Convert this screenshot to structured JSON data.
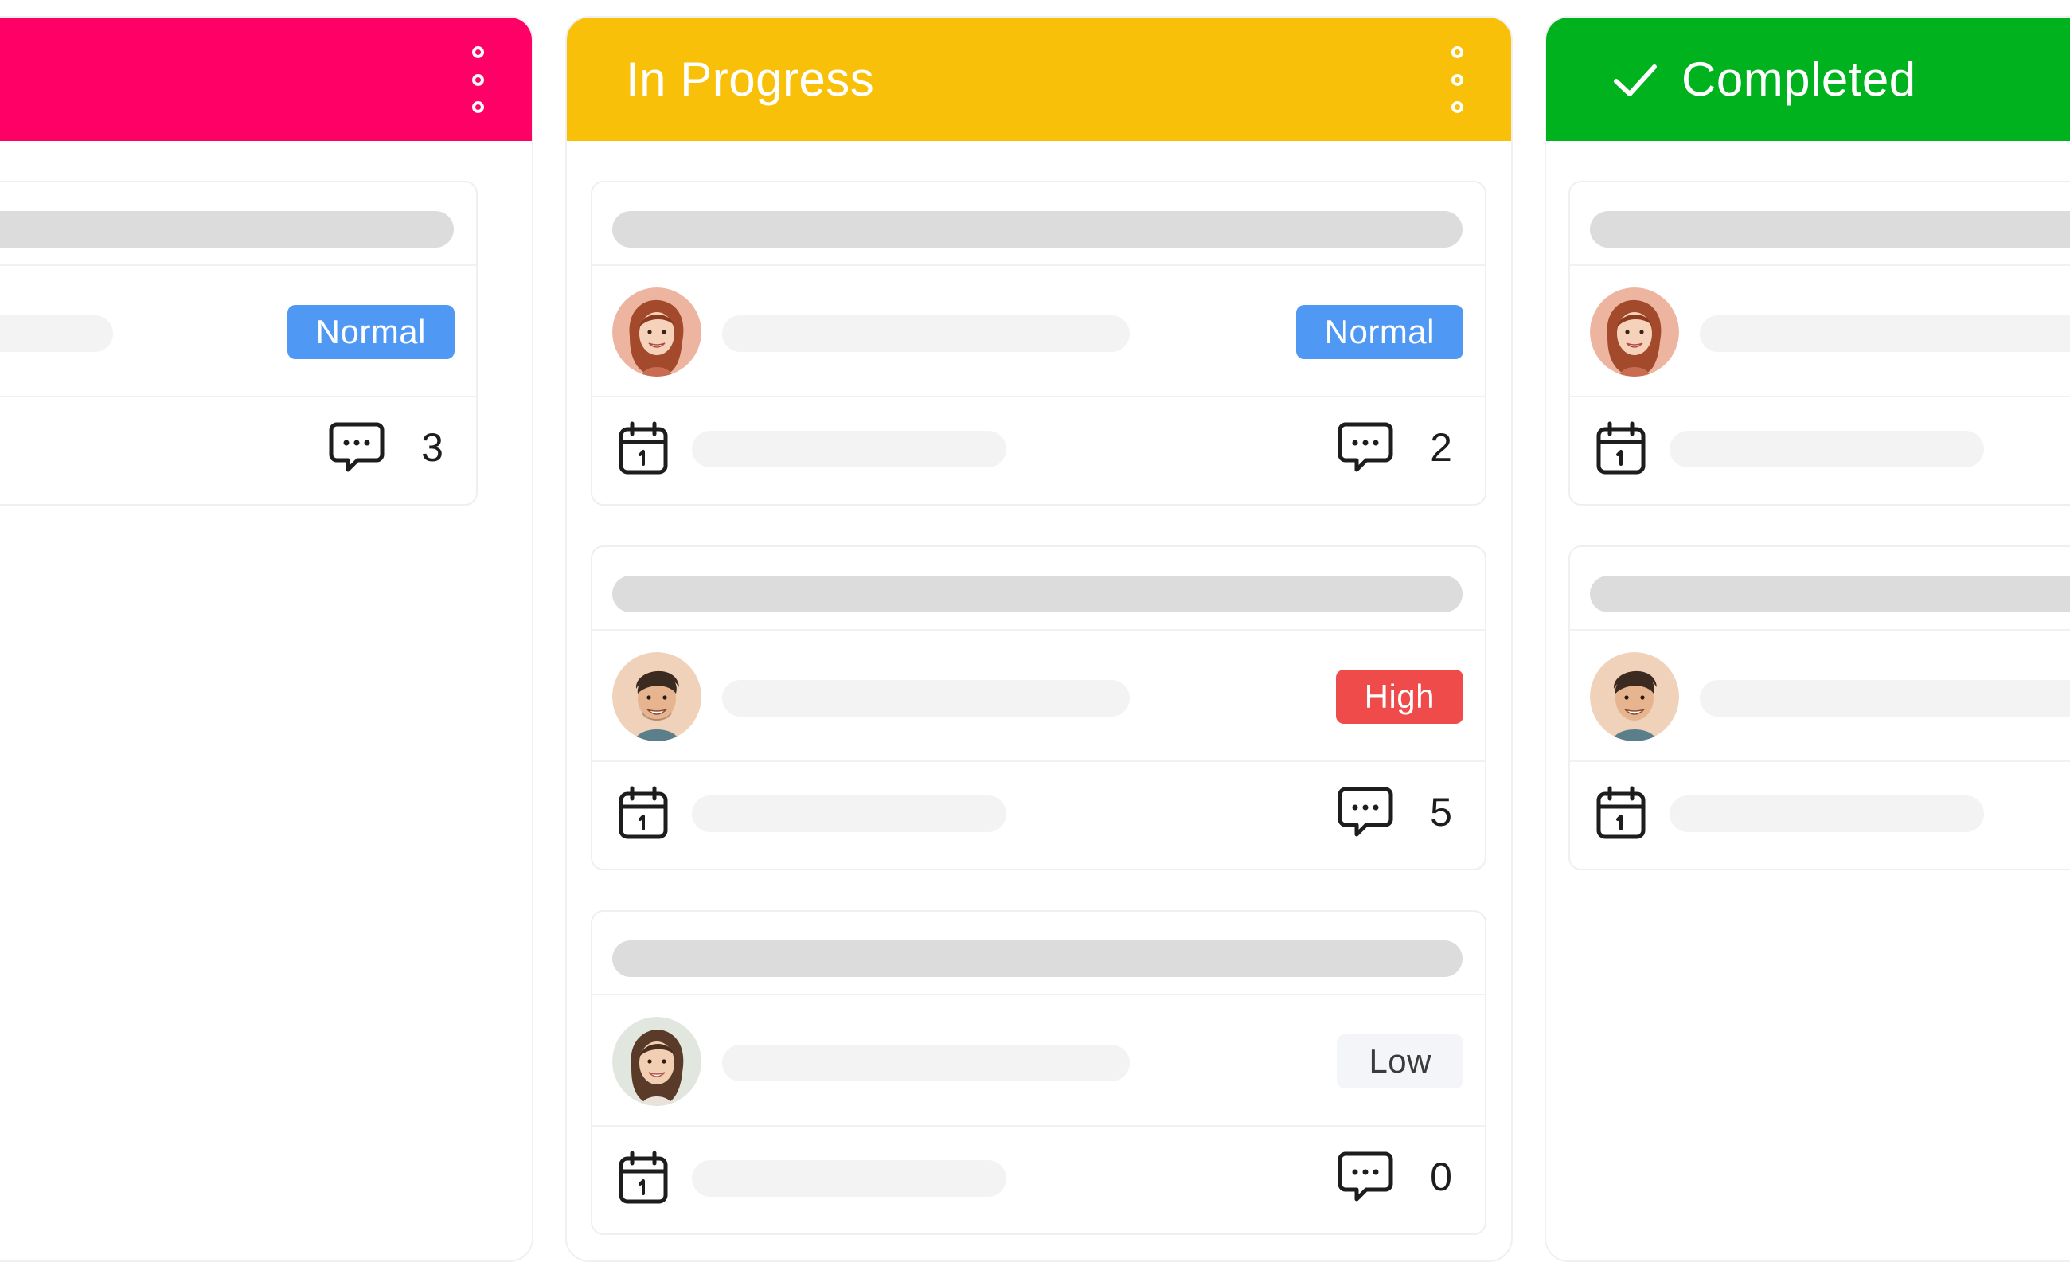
{
  "columns": [
    {
      "title": "",
      "color": "#ff0066",
      "has_menu": true,
      "cards": [
        {
          "avatar": null,
          "priority": "Normal",
          "priority_color": "#4f99f4",
          "comments": "3"
        }
      ]
    },
    {
      "title": "In Progress",
      "color": "#f9c00a",
      "has_menu": true,
      "cards": [
        {
          "avatar": "woman-avatar-red-hair",
          "priority": "Normal",
          "priority_color": "#4f99f4",
          "comments": "2"
        },
        {
          "avatar": "man-avatar",
          "priority": "High",
          "priority_color": "#ef4b4b",
          "comments": "5"
        },
        {
          "avatar": "woman-avatar-dark-hair",
          "priority": "Low",
          "priority_color": "#f3f5f9",
          "comments": "0"
        }
      ]
    },
    {
      "title": "Completed",
      "color": "#00b31e",
      "icon": "check-icon",
      "cards": [
        {
          "avatar": "woman-avatar-red-hair"
        },
        {
          "avatar": "man-avatar"
        }
      ]
    }
  ]
}
